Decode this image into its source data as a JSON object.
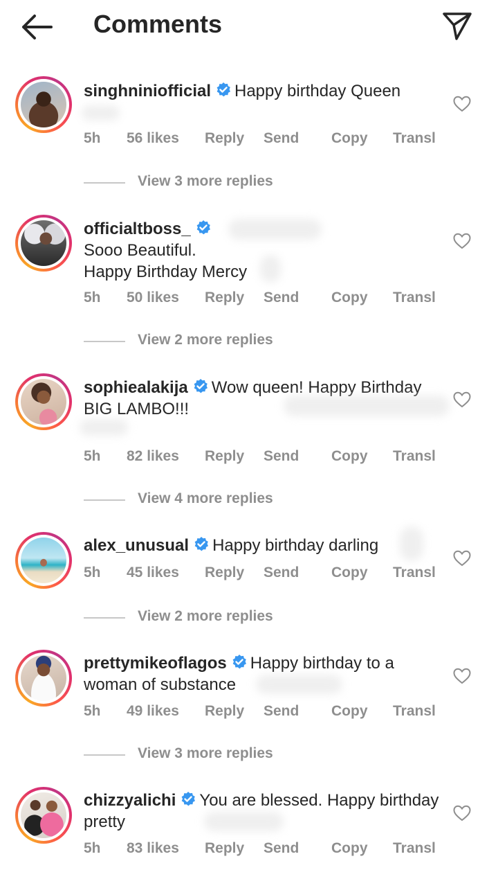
{
  "header": {
    "title": "Comments",
    "back_icon": "arrow-left-icon",
    "send_icon": "paper-plane-icon"
  },
  "actions": {
    "reply": "Reply",
    "send": "Send",
    "copy": "Copy",
    "translate": "Transl"
  },
  "colors": {
    "verified": "#3897f0",
    "meta": "#8e8e8e",
    "text": "#262626"
  },
  "comments": [
    {
      "username": "singhniniofficial",
      "verified": true,
      "text": "Happy birthday Queen",
      "time": "5h",
      "likes": "56 likes",
      "view_replies": "View 3 more replies"
    },
    {
      "username": "officialtboss_",
      "verified": true,
      "text": "Sooo Beautiful.\nHappy Birthday Mercy",
      "time": "5h",
      "likes": "50 likes",
      "view_replies": "View 2 more replies"
    },
    {
      "username": "sophiealakija",
      "verified": true,
      "text": "Wow queen! Happy Birthday BIG LAMBO!!!",
      "time": "5h",
      "likes": "82 likes",
      "view_replies": "View 4 more replies"
    },
    {
      "username": "alex_unusual",
      "verified": true,
      "text": "Happy birthday darling",
      "time": "5h",
      "likes": "45 likes",
      "view_replies": "View 2 more replies"
    },
    {
      "username": "prettymikeoflagos",
      "verified": true,
      "text": "Happy birthday to a woman of substance",
      "time": "5h",
      "likes": "49 likes",
      "view_replies": "View 3 more replies"
    },
    {
      "username": "chizzyalichi",
      "verified": true,
      "text": "You are blessed. Happy birthday pretty",
      "time": "5h",
      "likes": "83 likes"
    }
  ]
}
